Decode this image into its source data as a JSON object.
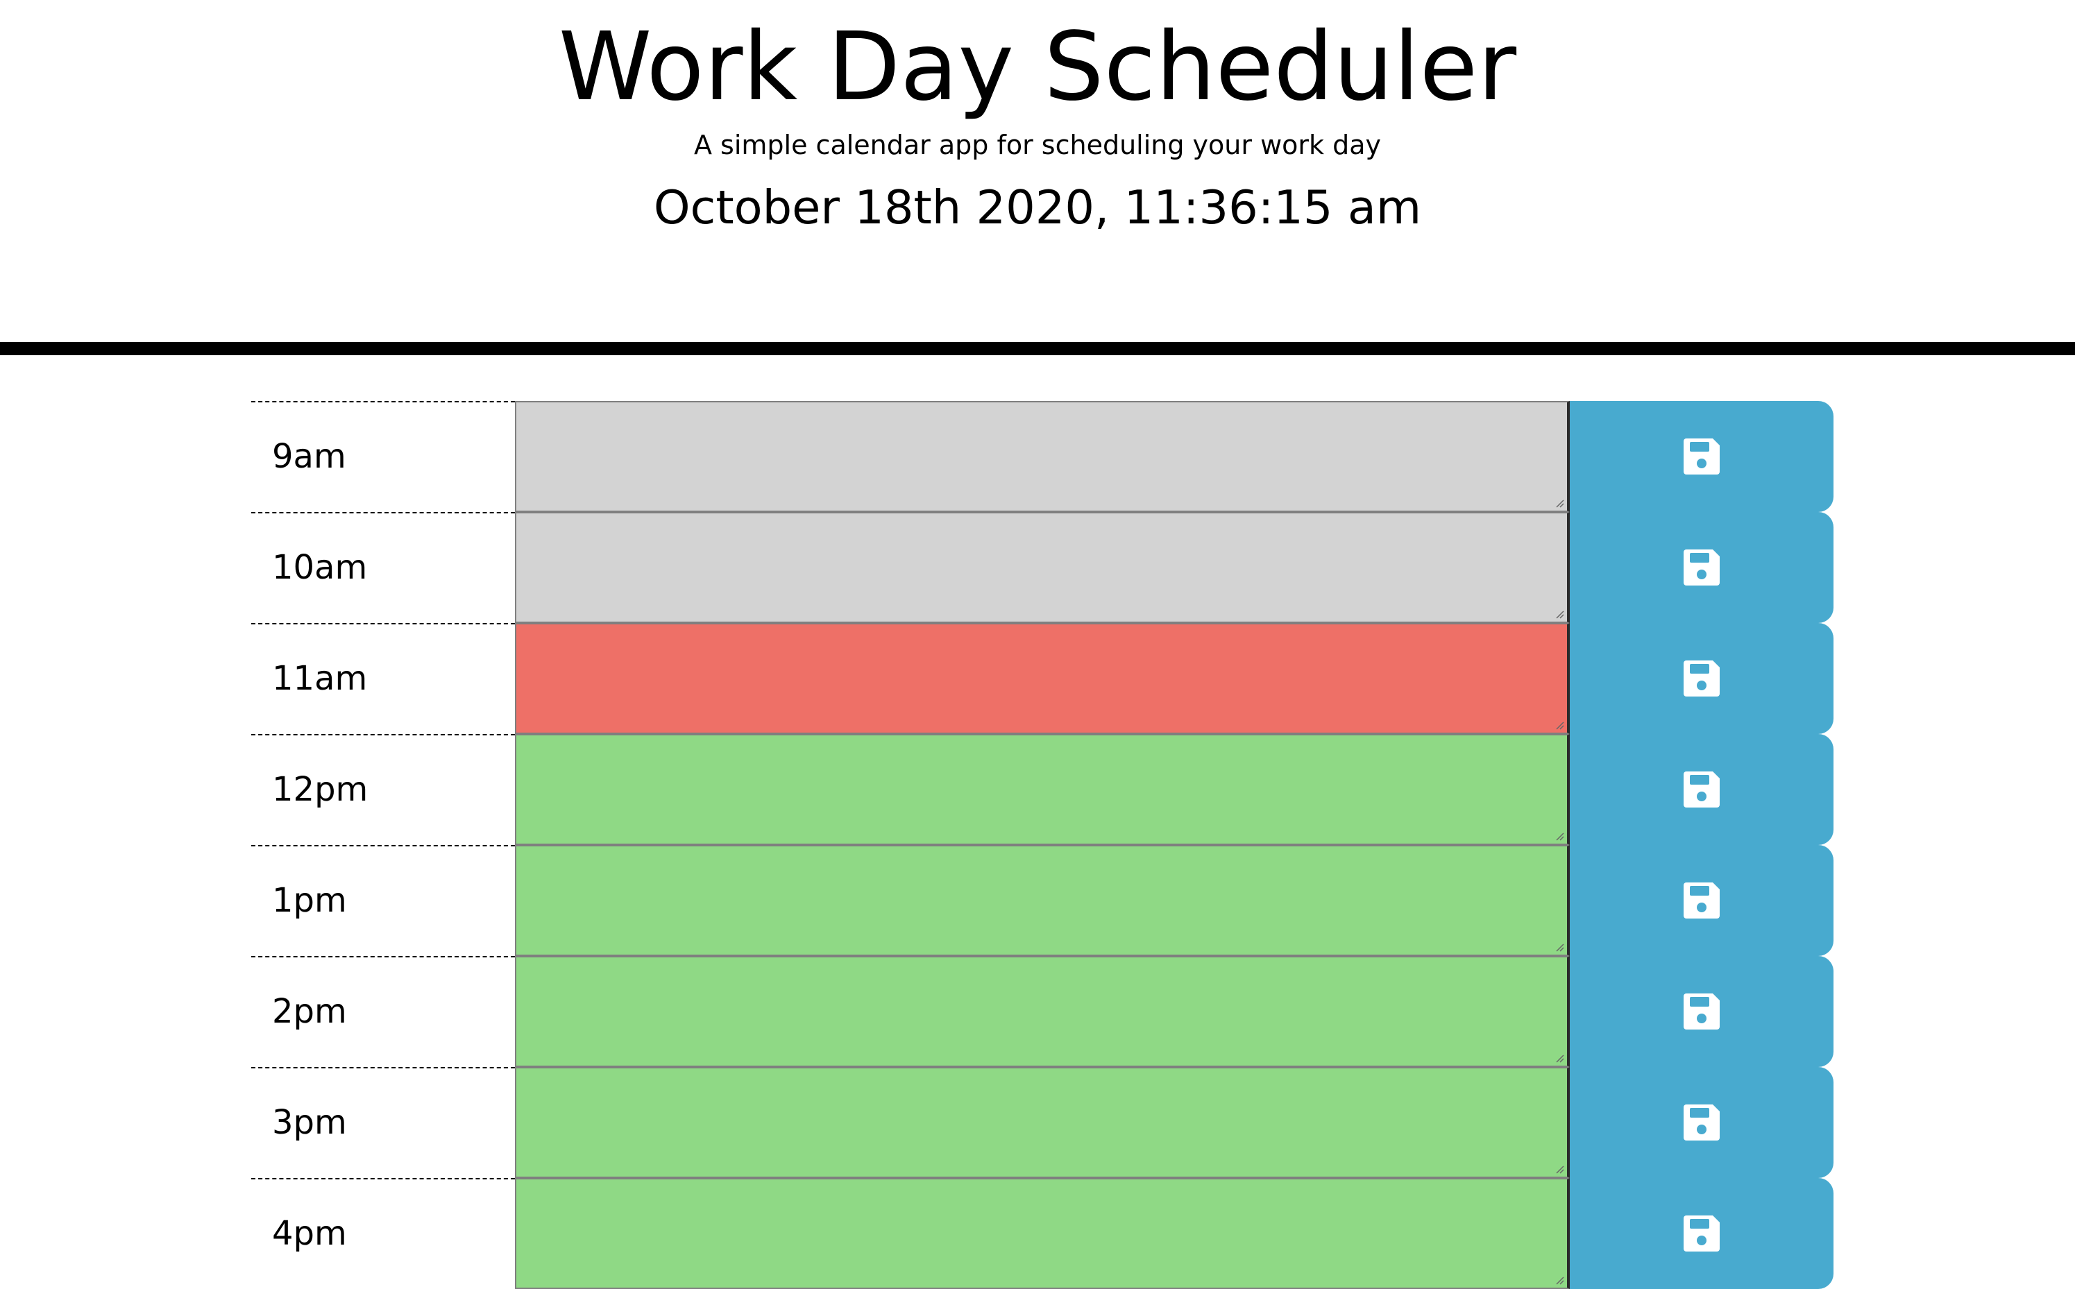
{
  "header": {
    "title": "Work Day Scheduler",
    "lead": "A simple calendar app for scheduling your work day",
    "current_day": "October 18th 2020, 11:36:15 am"
  },
  "colors": {
    "past": "#d3d3d3",
    "present": "#ee7067",
    "future": "#8fd985",
    "save_button": "#48aacf",
    "header_rule": "#000000"
  },
  "time_blocks": [
    {
      "hour": "9am",
      "status": "past",
      "text": "",
      "save_icon": "floppy-disk-icon"
    },
    {
      "hour": "10am",
      "status": "past",
      "text": "",
      "save_icon": "floppy-disk-icon"
    },
    {
      "hour": "11am",
      "status": "present",
      "text": "",
      "save_icon": "floppy-disk-icon"
    },
    {
      "hour": "12pm",
      "status": "future",
      "text": "",
      "save_icon": "floppy-disk-icon"
    },
    {
      "hour": "1pm",
      "status": "future",
      "text": "",
      "save_icon": "floppy-disk-icon"
    },
    {
      "hour": "2pm",
      "status": "future",
      "text": "",
      "save_icon": "floppy-disk-icon"
    },
    {
      "hour": "3pm",
      "status": "future",
      "text": "",
      "save_icon": "floppy-disk-icon"
    },
    {
      "hour": "4pm",
      "status": "future",
      "text": "",
      "save_icon": "floppy-disk-icon"
    }
  ]
}
